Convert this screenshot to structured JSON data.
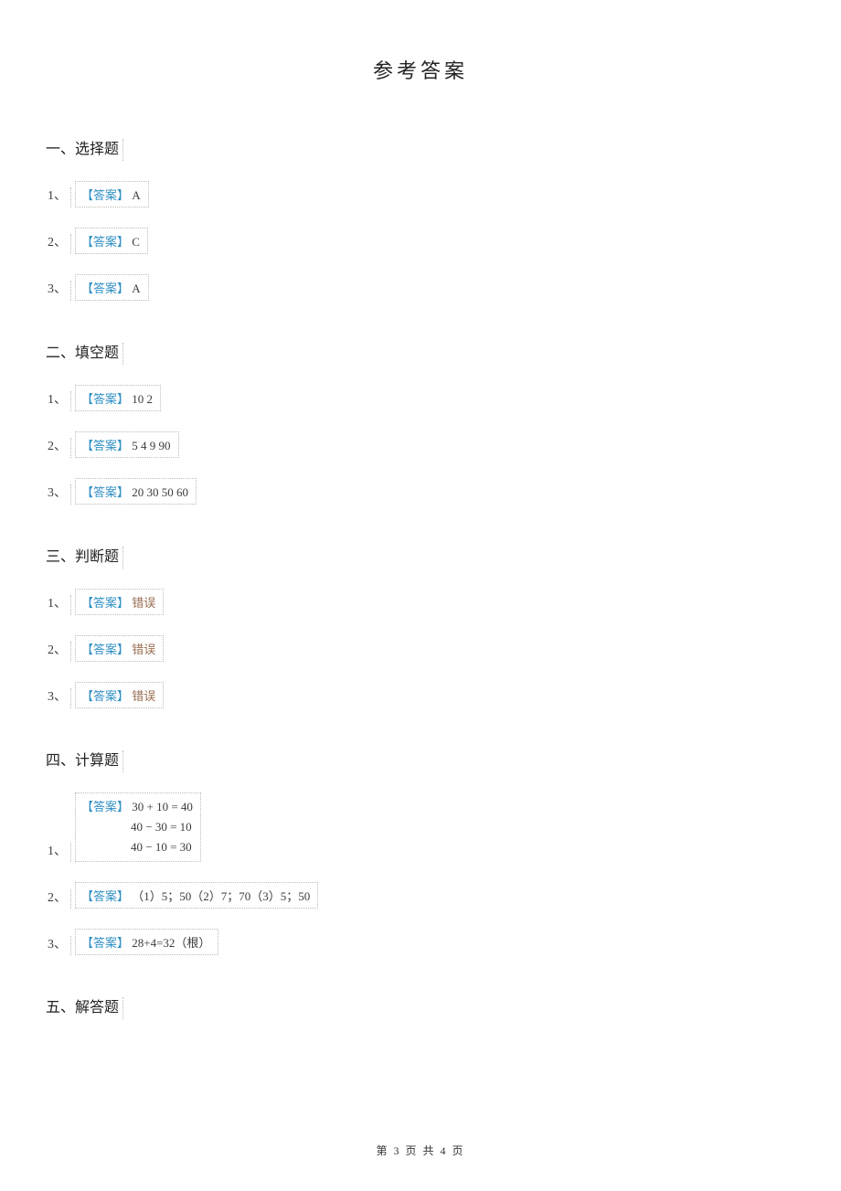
{
  "title": "参考答案",
  "answer_label": "【答案】",
  "err_word": "错误",
  "sections": {
    "s1": {
      "header": "一、选择题",
      "items": [
        "1、",
        "2、",
        "3、"
      ],
      "answers": [
        "A",
        "C",
        "A"
      ]
    },
    "s2": {
      "header": "二、填空题",
      "items": [
        "1、",
        "2、",
        "3、"
      ],
      "answers": [
        "10 2",
        "5 4 9 90",
        " 20 30 50 60"
      ]
    },
    "s3": {
      "header": "三、判断题",
      "items": [
        "1、",
        "2、",
        "3、"
      ]
    },
    "s4": {
      "header": "四、计算题",
      "items": [
        "1、",
        "2、",
        "3、"
      ],
      "a1_line1": " 30 + 10 = 40",
      "a1_line2": "40 − 30 = 10",
      "a1_line3": "40 − 10 = 30",
      "a2": " （1）5；50（2）7；70（3）5；50",
      "a3": " 28+4=32（根）"
    },
    "s5": {
      "header": "五、解答题"
    }
  },
  "footer": "第 3 页 共 4 页"
}
